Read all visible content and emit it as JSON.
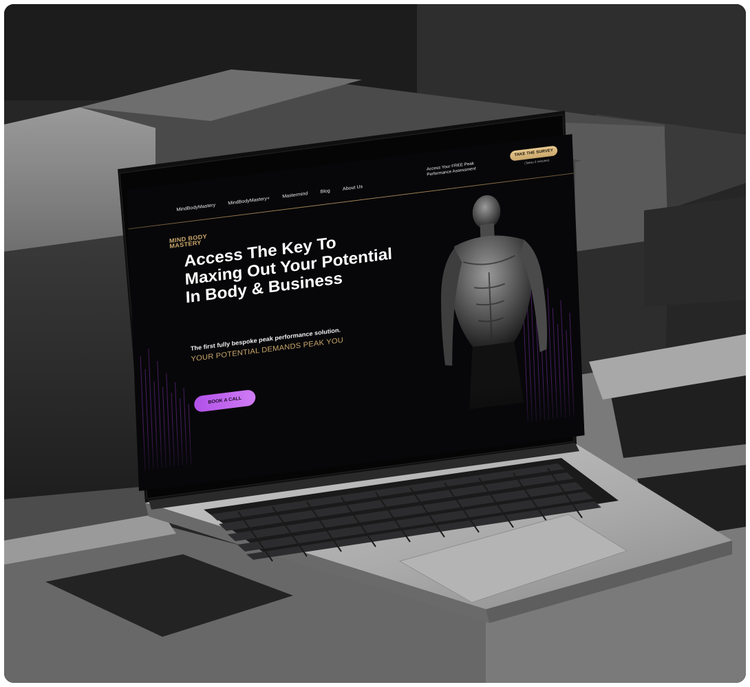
{
  "nav": {
    "links": [
      "MindBodyMastery",
      "MindBodyMastery+",
      "Mastermind",
      "Blog",
      "About Us"
    ],
    "cta_text": "Access Your FREE Peak Performance Assessment",
    "survey_button": "TAKE THE SURVEY",
    "survey_note": "(Takes 2 minutes)"
  },
  "logo": {
    "line1": "MIND BODY",
    "line2": "MASTERY"
  },
  "hero": {
    "headline": "Access The Key To Maxing Out Your Potential In Body & Business",
    "subline": "The first fully bespoke peak performance solution.",
    "tagline": "YOUR POTENTIAL DEMANDS PEAK YOU",
    "cta": "BOOK A CALL"
  },
  "colors": {
    "gold": "#c9a66b",
    "purple": "#b150e8",
    "screen_bg": "#070709"
  }
}
